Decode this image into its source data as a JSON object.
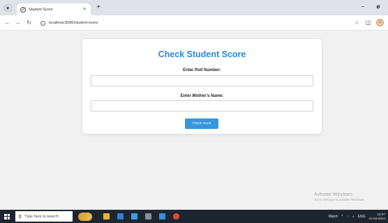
{
  "browser": {
    "tab_title": "Student Score",
    "tab_close": "×",
    "new_tab": "+",
    "url": "localhost:8080/student-score",
    "window_minimize": "−",
    "window_close": "ø"
  },
  "form": {
    "title": "Check Student Score",
    "roll_label": "Enter Roll Number:",
    "roll_value": "",
    "mother_label": "Enter Mother's Name:",
    "mother_value": "",
    "submit_label": "Check Score"
  },
  "watermark": {
    "title": "Activate Windows",
    "subtitle": "Go to Settings to activate Windows."
  },
  "taskbar": {
    "search_placeholder": "Type here to search",
    "tray_match": "Match",
    "tray_lang": "ENG",
    "clock_time": "12:07",
    "clock_date": "21-03-2024",
    "apps": [
      {
        "name": "file-explorer-icon",
        "color": "#e8b730"
      },
      {
        "name": "store-icon",
        "color": "#2f7fd6"
      },
      {
        "name": "mail-icon",
        "color": "#3c9be8"
      },
      {
        "name": "terminal-icon",
        "color": "#8a8f96"
      },
      {
        "name": "vscode-icon",
        "color": "#2f8ee0"
      },
      {
        "name": "chrome-icon",
        "color": "#e14b3b"
      }
    ]
  },
  "colors": {
    "title_blue": "#2b88d8",
    "button_blue": "#3498db",
    "taskbar": "#1d2530"
  }
}
